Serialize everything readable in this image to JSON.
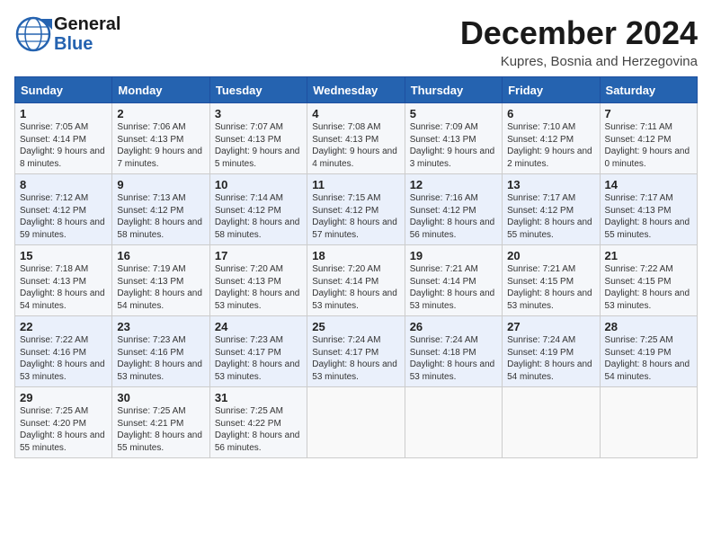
{
  "header": {
    "logo_line1": "General",
    "logo_line2": "Blue",
    "month": "December 2024",
    "location": "Kupres, Bosnia and Herzegovina"
  },
  "days_of_week": [
    "Sunday",
    "Monday",
    "Tuesday",
    "Wednesday",
    "Thursday",
    "Friday",
    "Saturday"
  ],
  "weeks": [
    [
      {
        "day": 1,
        "sunrise": "7:05 AM",
        "sunset": "4:14 PM",
        "daylight": "9 hours and 8 minutes."
      },
      {
        "day": 2,
        "sunrise": "7:06 AM",
        "sunset": "4:13 PM",
        "daylight": "9 hours and 7 minutes."
      },
      {
        "day": 3,
        "sunrise": "7:07 AM",
        "sunset": "4:13 PM",
        "daylight": "9 hours and 5 minutes."
      },
      {
        "day": 4,
        "sunrise": "7:08 AM",
        "sunset": "4:13 PM",
        "daylight": "9 hours and 4 minutes."
      },
      {
        "day": 5,
        "sunrise": "7:09 AM",
        "sunset": "4:13 PM",
        "daylight": "9 hours and 3 minutes."
      },
      {
        "day": 6,
        "sunrise": "7:10 AM",
        "sunset": "4:12 PM",
        "daylight": "9 hours and 2 minutes."
      },
      {
        "day": 7,
        "sunrise": "7:11 AM",
        "sunset": "4:12 PM",
        "daylight": "9 hours and 0 minutes."
      }
    ],
    [
      {
        "day": 8,
        "sunrise": "7:12 AM",
        "sunset": "4:12 PM",
        "daylight": "8 hours and 59 minutes."
      },
      {
        "day": 9,
        "sunrise": "7:13 AM",
        "sunset": "4:12 PM",
        "daylight": "8 hours and 58 minutes."
      },
      {
        "day": 10,
        "sunrise": "7:14 AM",
        "sunset": "4:12 PM",
        "daylight": "8 hours and 58 minutes."
      },
      {
        "day": 11,
        "sunrise": "7:15 AM",
        "sunset": "4:12 PM",
        "daylight": "8 hours and 57 minutes."
      },
      {
        "day": 12,
        "sunrise": "7:16 AM",
        "sunset": "4:12 PM",
        "daylight": "8 hours and 56 minutes."
      },
      {
        "day": 13,
        "sunrise": "7:17 AM",
        "sunset": "4:12 PM",
        "daylight": "8 hours and 55 minutes."
      },
      {
        "day": 14,
        "sunrise": "7:17 AM",
        "sunset": "4:13 PM",
        "daylight": "8 hours and 55 minutes."
      }
    ],
    [
      {
        "day": 15,
        "sunrise": "7:18 AM",
        "sunset": "4:13 PM",
        "daylight": "8 hours and 54 minutes."
      },
      {
        "day": 16,
        "sunrise": "7:19 AM",
        "sunset": "4:13 PM",
        "daylight": "8 hours and 54 minutes."
      },
      {
        "day": 17,
        "sunrise": "7:20 AM",
        "sunset": "4:13 PM",
        "daylight": "8 hours and 53 minutes."
      },
      {
        "day": 18,
        "sunrise": "7:20 AM",
        "sunset": "4:14 PM",
        "daylight": "8 hours and 53 minutes."
      },
      {
        "day": 19,
        "sunrise": "7:21 AM",
        "sunset": "4:14 PM",
        "daylight": "8 hours and 53 minutes."
      },
      {
        "day": 20,
        "sunrise": "7:21 AM",
        "sunset": "4:15 PM",
        "daylight": "8 hours and 53 minutes."
      },
      {
        "day": 21,
        "sunrise": "7:22 AM",
        "sunset": "4:15 PM",
        "daylight": "8 hours and 53 minutes."
      }
    ],
    [
      {
        "day": 22,
        "sunrise": "7:22 AM",
        "sunset": "4:16 PM",
        "daylight": "8 hours and 53 minutes."
      },
      {
        "day": 23,
        "sunrise": "7:23 AM",
        "sunset": "4:16 PM",
        "daylight": "8 hours and 53 minutes."
      },
      {
        "day": 24,
        "sunrise": "7:23 AM",
        "sunset": "4:17 PM",
        "daylight": "8 hours and 53 minutes."
      },
      {
        "day": 25,
        "sunrise": "7:24 AM",
        "sunset": "4:17 PM",
        "daylight": "8 hours and 53 minutes."
      },
      {
        "day": 26,
        "sunrise": "7:24 AM",
        "sunset": "4:18 PM",
        "daylight": "8 hours and 53 minutes."
      },
      {
        "day": 27,
        "sunrise": "7:24 AM",
        "sunset": "4:19 PM",
        "daylight": "8 hours and 54 minutes."
      },
      {
        "day": 28,
        "sunrise": "7:25 AM",
        "sunset": "4:19 PM",
        "daylight": "8 hours and 54 minutes."
      }
    ],
    [
      {
        "day": 29,
        "sunrise": "7:25 AM",
        "sunset": "4:20 PM",
        "daylight": "8 hours and 55 minutes."
      },
      {
        "day": 30,
        "sunrise": "7:25 AM",
        "sunset": "4:21 PM",
        "daylight": "8 hours and 55 minutes."
      },
      {
        "day": 31,
        "sunrise": "7:25 AM",
        "sunset": "4:22 PM",
        "daylight": "8 hours and 56 minutes."
      },
      null,
      null,
      null,
      null
    ]
  ],
  "labels": {
    "sunrise": "Sunrise:",
    "sunset": "Sunset:",
    "daylight": "Daylight:"
  }
}
